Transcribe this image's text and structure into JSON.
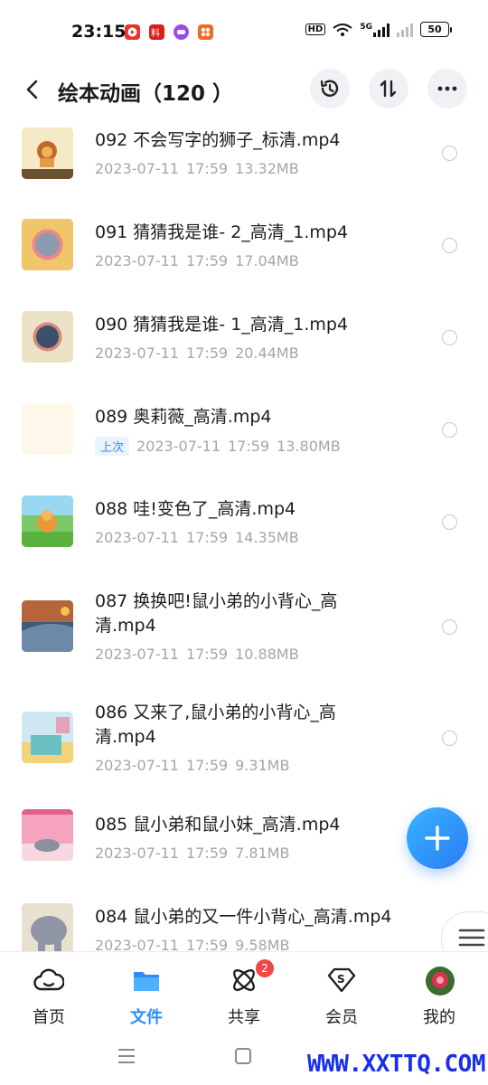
{
  "status_bar": {
    "time": "23:15",
    "hd_label": "HD",
    "network": "5G",
    "battery": "50",
    "notification_icons": [
      "video-app-icon",
      "news-app-icon",
      "chat-app-icon",
      "shopping-app-icon"
    ]
  },
  "header": {
    "title": "绘本动画（120 ）",
    "actions": [
      "history-icon",
      "sort-icon",
      "more-icon"
    ]
  },
  "files": [
    {
      "name": "092 不会写字的狮子_标清.mp4",
      "date": "2023-07-11",
      "time": "17:59",
      "size": "13.32MB",
      "tag": ""
    },
    {
      "name": "091 猜猜我是谁- 2_高清_1.mp4",
      "date": "2023-07-11",
      "time": "17:59",
      "size": "17.04MB",
      "tag": ""
    },
    {
      "name": "090 猜猜我是谁- 1_高清_1.mp4",
      "date": "2023-07-11",
      "time": "17:59",
      "size": "20.44MB",
      "tag": ""
    },
    {
      "name": "089 奥莉薇_高清.mp4",
      "date": "2023-07-11",
      "time": "17:59",
      "size": "13.80MB",
      "tag": "上次"
    },
    {
      "name": "088 哇!变色了_高清.mp4",
      "date": "2023-07-11",
      "time": "17:59",
      "size": "14.35MB",
      "tag": ""
    },
    {
      "name": "087 换换吧!鼠小弟的小背心_高清.mp4",
      "date": "2023-07-11",
      "time": "17:59",
      "size": "10.88MB",
      "tag": ""
    },
    {
      "name": "086 又来了,鼠小弟的小背心_高清.mp4",
      "date": "2023-07-11",
      "time": "17:59",
      "size": "9.31MB",
      "tag": ""
    },
    {
      "name": "085 鼠小弟和鼠小妹_高清.mp4",
      "date": "2023-07-11",
      "time": "17:59",
      "size": "7.81MB",
      "tag": ""
    },
    {
      "name": "084 鼠小弟的又一件小背心_高清.mp4",
      "date": "2023-07-11",
      "time": "17:59",
      "size": "9.58MB",
      "tag": ""
    }
  ],
  "fab": {
    "icon": "plus-icon"
  },
  "nav": [
    {
      "label": "首页",
      "icon": "cloud-icon",
      "active": false
    },
    {
      "label": "文件",
      "icon": "folder-icon",
      "active": true
    },
    {
      "label": "共享",
      "icon": "share-atom-icon",
      "active": false,
      "badge": "2"
    },
    {
      "label": "会员",
      "icon": "vip-diamond-icon",
      "active": false
    },
    {
      "label": "我的",
      "icon": "avatar",
      "active": false
    }
  ],
  "watermark": "WWW.XXTTQ.COM",
  "colors": {
    "accent": "#2b8cf7",
    "badge": "#f04747",
    "meta": "#a3a6ad"
  }
}
